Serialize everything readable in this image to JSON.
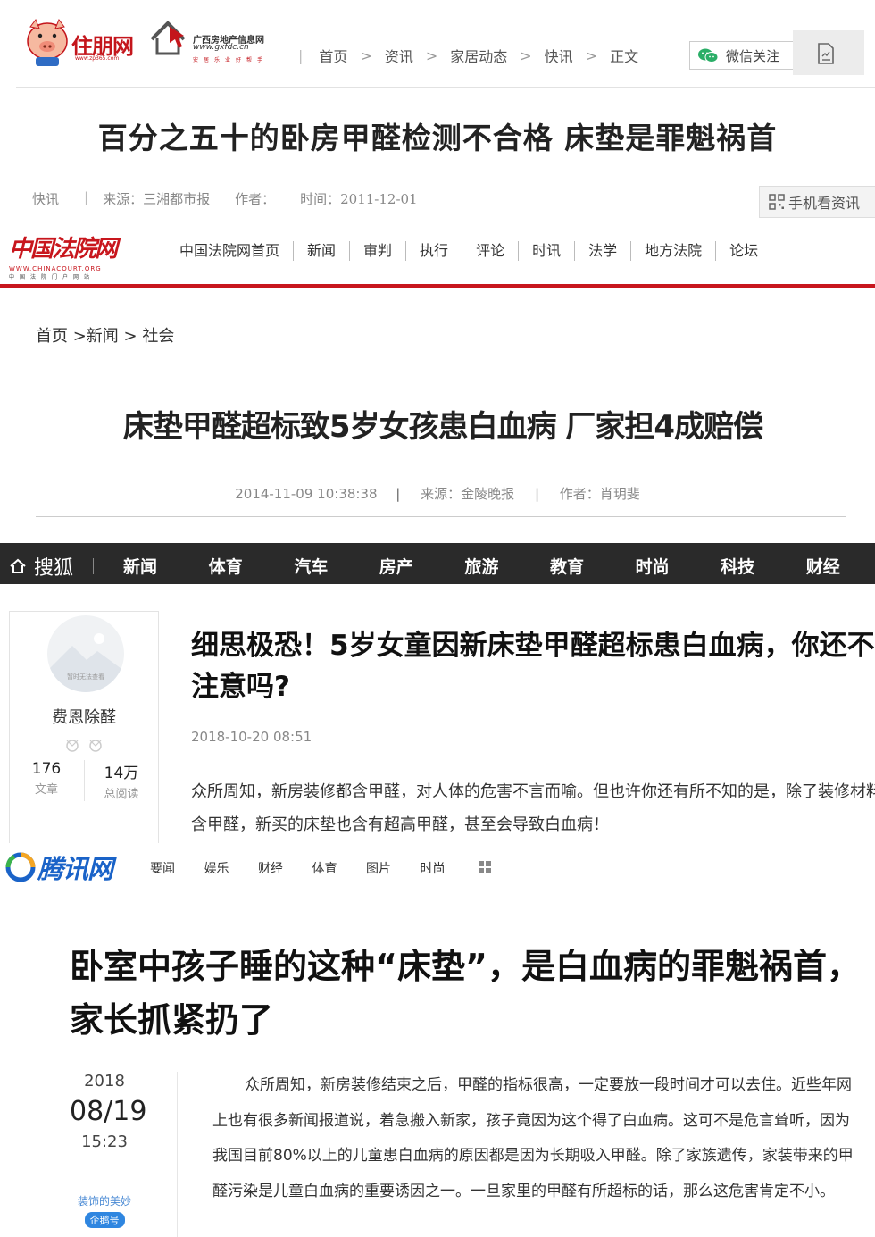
{
  "site1": {
    "logo_text": "住朋网",
    "logo_sub": "www.zp365.com",
    "partner_logo": {
      "line1": "广西房地产信息网",
      "line2": "www.gxfdc.cn",
      "line3": "安居乐业好帮手"
    },
    "breadcrumb": [
      "首页",
      "资讯",
      "家居动态",
      "快讯",
      "正文"
    ],
    "wechat_button": "微信关注",
    "title": "百分之五十的卧房甲醛检测不合格 床垫是罪魁祸首",
    "meta": {
      "category": "快讯",
      "source": "来源：三湘都市报",
      "author": "作者：",
      "time": "时间：2011-12-01"
    },
    "mobile_button": "手机看资讯"
  },
  "site2": {
    "logo_text": "中国法院网",
    "logo_en": "WWW.CHINACOURT.ORG",
    "logo_cn": "中国法院门户网站",
    "nav": [
      "中国法院网首页",
      "新闻",
      "审判",
      "执行",
      "评论",
      "时讯",
      "法学",
      "地方法院",
      "论坛"
    ],
    "breadcrumb": "首页 >新闻 > 社会",
    "title": "床垫甲醛超标致5岁女孩患白血病 厂家担4成赔偿",
    "meta": {
      "datetime": "2014-11-09 10:38:38",
      "source": "来源：金陵晚报",
      "author": "作者：肖玥斐"
    }
  },
  "site3": {
    "logo_text": "搜狐",
    "nav": [
      "新闻",
      "体育",
      "汽车",
      "房产",
      "旅游",
      "教育",
      "时尚",
      "科技",
      "财经"
    ],
    "profile": {
      "avatar_label": "暂时无法查看",
      "name": "费恩除醛",
      "articles": "176",
      "articles_label": "文章",
      "reads": "14万",
      "reads_label": "总阅读"
    },
    "title": "细思极恐！5岁女童因新床垫甲醛超标患白血病，你还不注意吗?",
    "date": "2018-10-20 08:51",
    "body": "众所周知，新房装修都含甲醛，对人体的危害不言而喻。但也许你还有所不知的是，除了装修材料含甲醛，新买的床垫也含有超高甲醛，甚至会导致白血病！"
  },
  "site4": {
    "logo_text": "腾讯网",
    "nav": [
      "要闻",
      "娱乐",
      "财经",
      "体育",
      "图片",
      "时尚"
    ],
    "title": "卧室中孩子睡的这种“床垫”，是白血病的罪魁祸首，家长抓紧扔了",
    "date": {
      "year": "2018",
      "month_day": "08/19",
      "time": "15:23"
    },
    "author": {
      "name": "装饰的美妙",
      "badge": "企鹅号"
    },
    "body": "众所周知，新房装修结束之后，甲醛的指标很高，一定要放一段时间才可以去住。近些年网上也有很多新闻报道说，着急搬入新家，孩子竟因为这个得了白血病。这可不是危言耸听，因为我国目前80%以上的儿童患白血病的原因都是因为长期吸入甲醛。除了家族遗传，家装带来的甲醛污染是儿童白血病的重要诱因之一。一旦家里的甲醛有所超标的话，那么这危害肯定不小。"
  },
  "colors": {
    "zp_red": "#c4161c",
    "court_red": "#c8161d",
    "sohu_bar": "#2a2a2a",
    "qq_blue": "#1a63c8",
    "wechat_green": "#2aae67"
  }
}
